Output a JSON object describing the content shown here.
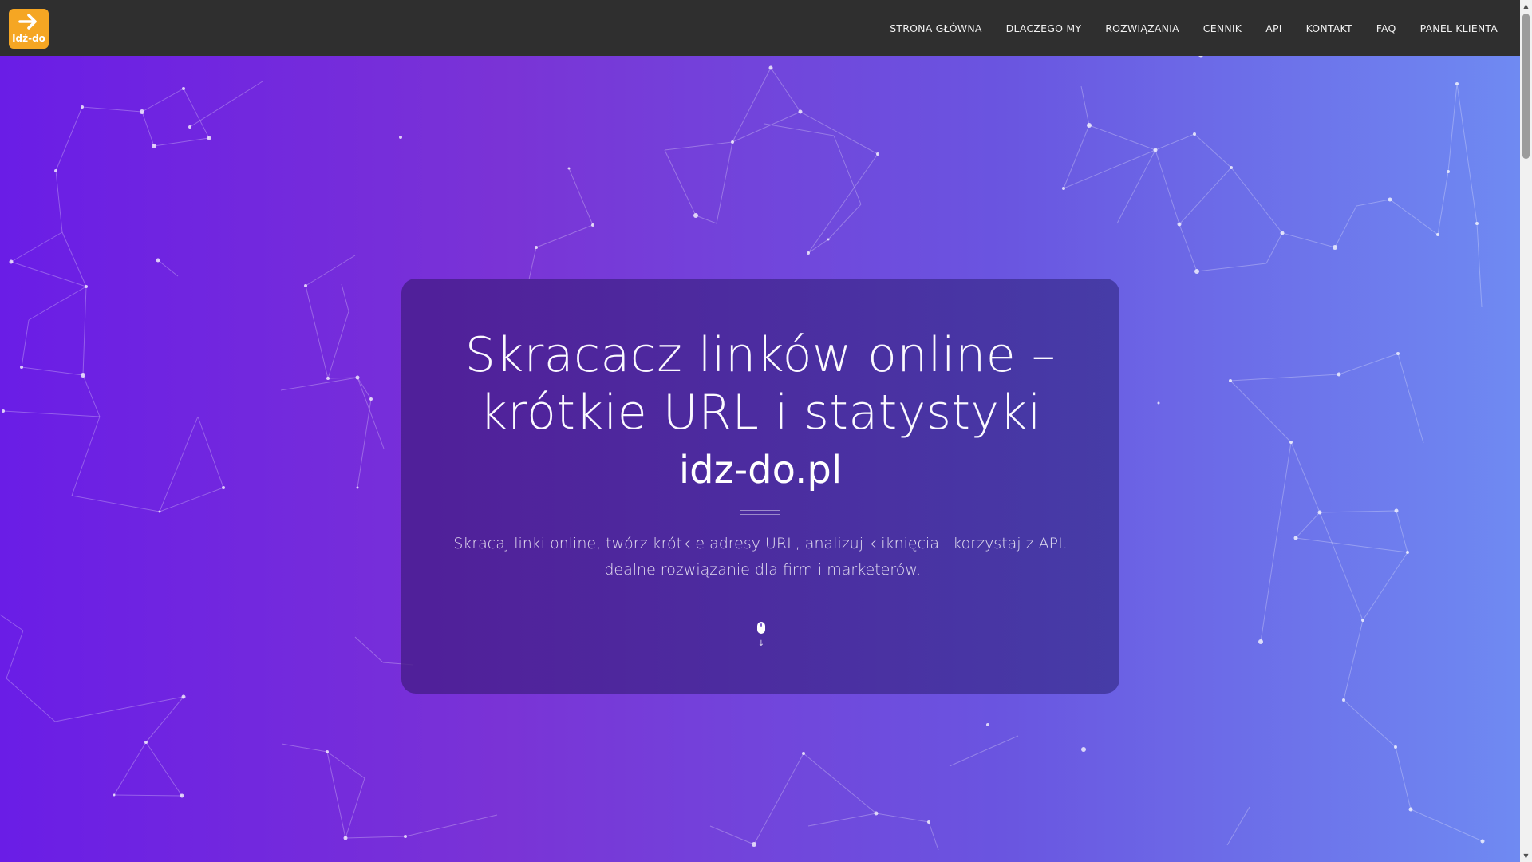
{
  "header": {
    "logo": {
      "icon": "arrow-right-icon",
      "text": "Idź-do",
      "background": "#f5a623"
    },
    "nav": [
      {
        "label": "STRONA GŁÓWNA"
      },
      {
        "label": "DLACZEGO MY"
      },
      {
        "label": "ROZWIĄZANIA"
      },
      {
        "label": "CENNIK"
      },
      {
        "label": "API"
      },
      {
        "label": "KONTAKT"
      },
      {
        "label": "FAQ"
      },
      {
        "label": "PANEL KLIENTA"
      }
    ],
    "background": "#2f2f2f"
  },
  "hero": {
    "title_line1": "Skracacz linków online –",
    "title_line2": "krótkie URL i statystyki",
    "domain": "idz-do.pl",
    "description_line1": "Skracaj linki online, twórz krótkie adresy URL, analizuj kliknięcia i korzystaj z API.",
    "description_line2": "Idealne rozwiązanie dla firm i marketerów.",
    "scroll_icon": "mouse-icon",
    "scroll_arrow": "↓",
    "gradient_colors": [
      "#6a1de6",
      "#7a33d6",
      "#6a55e0",
      "#6f8af2"
    ]
  },
  "scrollbar": {
    "up_arrow": "▲",
    "down_arrow": "▼"
  }
}
